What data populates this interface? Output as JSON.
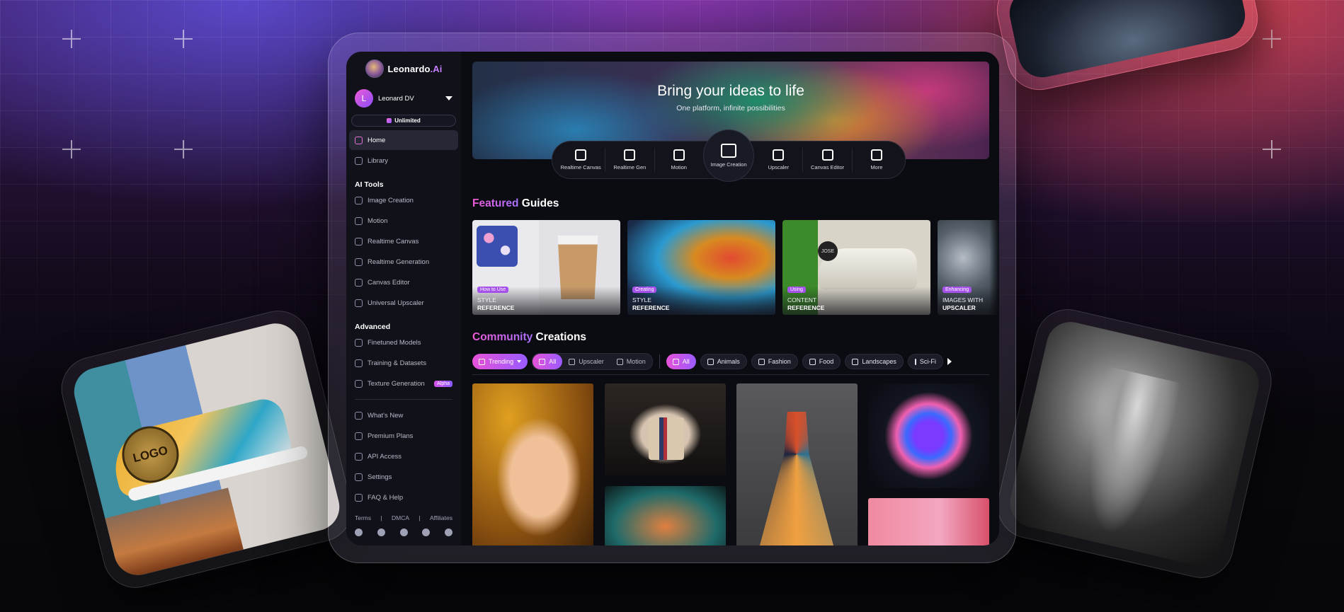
{
  "brand": {
    "name": "Leonardo",
    "suffix": ".Ai"
  },
  "user": {
    "initial": "L",
    "name": "Leonard DV",
    "plan": "Unlimited"
  },
  "sidebar": {
    "main_items": [
      {
        "label": "Home",
        "icon": "home-icon",
        "active": true
      },
      {
        "label": "Library",
        "icon": "grid-icon"
      }
    ],
    "ai_tools_title": "AI Tools",
    "ai_tools": [
      {
        "label": "Image Creation",
        "icon": "image-icon"
      },
      {
        "label": "Motion",
        "icon": "film-icon"
      },
      {
        "label": "Realtime Canvas",
        "icon": "brush-icon"
      },
      {
        "label": "Realtime Generation",
        "icon": "dots-grid-icon"
      },
      {
        "label": "Canvas Editor",
        "icon": "frame-icon"
      },
      {
        "label": "Universal Upscaler",
        "icon": "upscale-icon"
      }
    ],
    "advanced_title": "Advanced",
    "advanced": [
      {
        "label": "Finetuned Models",
        "icon": "cube-icon"
      },
      {
        "label": "Training & Datasets",
        "icon": "dataset-icon"
      },
      {
        "label": "Texture Generation",
        "icon": "texture-icon",
        "badge": "Alpha"
      }
    ],
    "bottom_items": [
      {
        "label": "What's New",
        "icon": "megaphone-icon"
      },
      {
        "label": "Premium Plans",
        "icon": "crown-icon"
      },
      {
        "label": "API Access",
        "icon": "key-icon"
      },
      {
        "label": "Settings",
        "icon": "gear-icon"
      },
      {
        "label": "FAQ & Help",
        "icon": "help-icon"
      }
    ],
    "footer_links": [
      "Terms",
      "|",
      "DMCA",
      "|",
      "Affiliates"
    ],
    "socials": [
      "discord-icon",
      "reddit-icon",
      "x-icon",
      "facebook-icon",
      "apple-icon"
    ]
  },
  "hero": {
    "title": "Bring your ideas to life",
    "subtitle": "One platform, infinite possibilities",
    "tools": [
      {
        "label": "Realtime Canvas",
        "icon": "brush-icon"
      },
      {
        "label": "Realtime Gen",
        "icon": "dots-grid-icon"
      },
      {
        "label": "Motion",
        "icon": "film-icon"
      },
      {
        "label": "Image Creation",
        "icon": "image-icon",
        "primary": true
      },
      {
        "label": "Upscaler",
        "icon": "upscale-icon"
      },
      {
        "label": "Canvas Editor",
        "icon": "frame-icon"
      },
      {
        "label": "More",
        "icon": "sparkle-icon"
      }
    ]
  },
  "featured": {
    "title_accent": "Featured",
    "title_rest": " Guides",
    "guides": [
      {
        "tag": "How to Use",
        "line1": "STYLE",
        "line2": "REFERENCE"
      },
      {
        "tag": "Creating",
        "line1": "STYLE",
        "line2": "REFERENCE"
      },
      {
        "tag": "Using",
        "line1": "CONTENT",
        "line2": "REFERENCE"
      },
      {
        "tag": "Enhancing",
        "line1": "IMAGES WITH",
        "line2": "UPSCALER"
      }
    ],
    "badge_text": "JOSE"
  },
  "community": {
    "title_accent": "Community",
    "title_rest": " Creations",
    "sort": "Trending",
    "media_filters": [
      "All",
      "Upscaler",
      "Motion"
    ],
    "category_filters": [
      "All",
      "Animals",
      "Fashion",
      "Food",
      "Landscapes",
      "Sci-Fi"
    ]
  },
  "side_cards": {
    "logo_text": "LOGO"
  },
  "colors": {
    "accent_start": "#e652d8",
    "accent_end": "#9a5bff",
    "panel": "#101119",
    "screen": "#0b0c12"
  }
}
